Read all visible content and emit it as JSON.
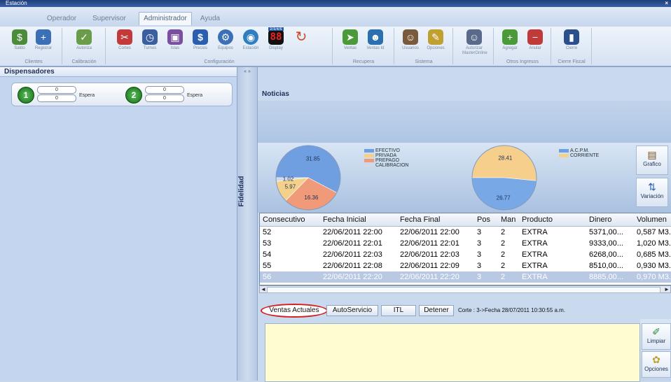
{
  "window": {
    "title": "Estación"
  },
  "menu": {
    "tabs": [
      {
        "label": "Operador",
        "active": false
      },
      {
        "label": "Supervisor",
        "active": false
      },
      {
        "label": "Administrador",
        "active": true
      },
      {
        "label": "Ayuda",
        "active": false
      }
    ]
  },
  "ribbon": {
    "groups": [
      {
        "label": "Clientes",
        "buttons": [
          {
            "label": "Saldo",
            "icon": "people-money-icon",
            "color": "#4a8c3a"
          },
          {
            "label": "Registrar",
            "icon": "people-add-icon",
            "color": "#3b6fb6"
          }
        ]
      },
      {
        "label": "Calibración",
        "buttons": [
          {
            "label": "Autoriza",
            "icon": "user-check-icon",
            "color": "#6a9c4a"
          }
        ]
      },
      {
        "label": "Configuración",
        "buttons": [
          {
            "label": "Cortes",
            "icon": "scissors-icon",
            "color": "#c23a3a"
          },
          {
            "label": "Turnos",
            "icon": "clock-icon",
            "color": "#3a5fa0"
          },
          {
            "label": "Islas",
            "icon": "island-icon",
            "color": "#7a4fa0"
          },
          {
            "label": "Precios",
            "icon": "dollar-icon",
            "color": "#2a5fb0"
          },
          {
            "label": "Equipos",
            "icon": "gear-icon",
            "color": "#3b6fb6"
          },
          {
            "label": "Estación",
            "icon": "globe-icon",
            "color": "#2f7fc0"
          },
          {
            "label": "Display",
            "icon": "led-display-icon",
            "color": "#111111",
            "display_text": "88",
            "display_badge": "2/3/4/5"
          },
          {
            "label": "",
            "icon": "refresh-icon",
            "color": "#d04a2a"
          }
        ]
      },
      {
        "label": "Recupera",
        "buttons": [
          {
            "label": "Ventas",
            "icon": "fish-icon",
            "color": "#4a9a3a"
          },
          {
            "label": "Ventas Id",
            "icon": "people-icon",
            "color": "#2a6fb0"
          }
        ]
      },
      {
        "label": "Sistema",
        "buttons": [
          {
            "label": "Usuarios",
            "icon": "users-icon",
            "color": "#7a5a3a"
          },
          {
            "label": "Opciones",
            "icon": "options-icon",
            "color": "#c0a030"
          }
        ]
      },
      {
        "label": "",
        "buttons": [
          {
            "label": "Autorizar MasterOnline",
            "icon": "user-authorize-icon",
            "color": "#5a6a8a"
          }
        ]
      },
      {
        "label": "Otros Ingresos",
        "buttons": [
          {
            "label": "Agregar",
            "icon": "add-item-icon",
            "color": "#4a9a3a"
          },
          {
            "label": "Anular",
            "icon": "cancel-item-icon",
            "color": "#c03a3a"
          }
        ]
      },
      {
        "label": "Cierre Fiscal",
        "buttons": [
          {
            "label": "Cierre",
            "icon": "door-icon",
            "color": "#2a4f8a"
          }
        ]
      }
    ]
  },
  "dispensadores": {
    "title": "Dispensadores",
    "units": [
      {
        "number": "1",
        "value_top": "0",
        "value_bottom": "0",
        "status": "Espera"
      },
      {
        "number": "2",
        "value_top": "0",
        "value_bottom": "0",
        "status": "Espera"
      }
    ]
  },
  "splitter": {
    "collapse": "« »",
    "label": "Fidelidad"
  },
  "noticias": {
    "title": "Noticias"
  },
  "charts": {
    "side_buttons": [
      {
        "label": "Grafico",
        "icon": "chart-icon"
      },
      {
        "label": "Variación",
        "icon": "variation-icon"
      }
    ]
  },
  "chart_data": [
    {
      "type": "pie",
      "labels": [
        "EFECTIVO",
        "PRIVADA",
        "PREPAGO",
        "CALIBRACION"
      ],
      "values": [
        31.85,
        16.36,
        5.97,
        1.02
      ],
      "colors": [
        "#6f9fe0",
        "#f09a7a",
        "#f3d18a",
        "#d2d9e6"
      ],
      "legend": [
        "EFECTIVO",
        "PRIVADA",
        "PREPAGO",
        "CALIBRACION"
      ],
      "legend_colors": [
        "#6f9fe0",
        "#f3d18a",
        "#f09a7a",
        "#d2d9e6"
      ]
    },
    {
      "type": "pie",
      "labels": [
        "A.C.P.M.",
        "CORRIENTE"
      ],
      "values": [
        28.41,
        26.77
      ],
      "colors": [
        "#f6cf8c",
        "#78a8e6"
      ],
      "legend": [
        "A.C.P.M.",
        "CORRIENTE"
      ],
      "legend_colors": [
        "#6f9fe0",
        "#f3d18a"
      ]
    }
  ],
  "grid": {
    "columns": [
      "Consecutivo",
      "Fecha Inicial",
      "Fecha Final",
      "Pos",
      "Man",
      "Producto",
      "Dinero",
      "Volumen"
    ],
    "rows": [
      [
        "52",
        "22/06/2011 22:00",
        "22/06/2011 22:00",
        "3",
        "2",
        "EXTRA",
        "5371,00...",
        "0,587 M3.."
      ],
      [
        "53",
        "22/06/2011 22:01",
        "22/06/2011 22:01",
        "3",
        "2",
        "EXTRA",
        "9333,00...",
        "1,020 M3.."
      ],
      [
        "54",
        "22/06/2011 22:03",
        "22/06/2011 22:03",
        "3",
        "2",
        "EXTRA",
        "6268,00...",
        "0,685 M3.."
      ],
      [
        "55",
        "22/06/2011 22:08",
        "22/06/2011 22:09",
        "3",
        "2",
        "EXTRA",
        "8510,00...",
        "0,930 M3.."
      ],
      [
        "56",
        "22/06/2011 22:20",
        "22/06/2011 22:20",
        "3",
        "2",
        "EXTRA",
        "8885,00...",
        "0,970 M3.."
      ]
    ],
    "selected_row": 4
  },
  "tabs": {
    "items": [
      {
        "label": "Ventas Actuales",
        "active": true
      },
      {
        "label": "AutoServicio",
        "active": false
      },
      {
        "label": "ITL",
        "active": false
      },
      {
        "label": "Detener",
        "active": false
      }
    ],
    "corte": "Corte : 3->Fecha 28/07/2011 10:30:55 a.m."
  },
  "tools": [
    {
      "label": "Limpiar",
      "icon": "broom-icon"
    },
    {
      "label": "Opciones",
      "icon": "options-icon"
    }
  ],
  "colors": {
    "accent_highlight": "#d42020",
    "notes_background": "#fdfdd0",
    "selected_row": "#b9c9e3"
  }
}
